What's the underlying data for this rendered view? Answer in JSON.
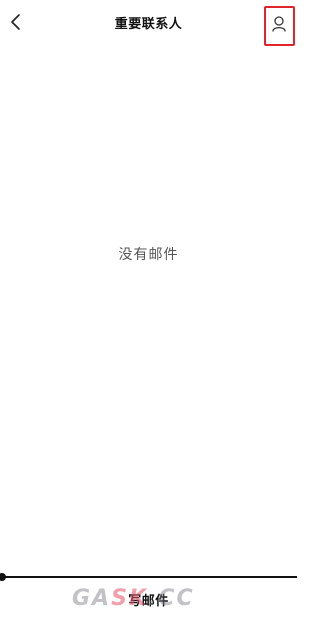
{
  "header": {
    "title": "重要联系人",
    "back_icon": "chevron-left-icon",
    "contact_icon": "person-icon",
    "highlight_color": "#e0242b"
  },
  "main": {
    "empty_text": "没有邮件"
  },
  "bottom": {
    "compose_label": "写邮件"
  },
  "watermark": {
    "part1": "GA",
    "part2": "SK",
    "part3": ".CC"
  }
}
